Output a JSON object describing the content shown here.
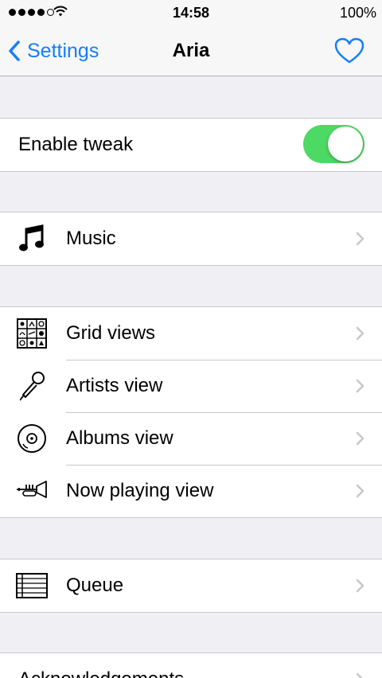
{
  "status_bar": {
    "time": "14:58",
    "battery": "100%",
    "signal_icon": "signal-dots-icon",
    "wifi_icon": "wifi-icon"
  },
  "nav": {
    "back_label": "Settings",
    "title": "Aria",
    "heart_icon": "heart-icon",
    "accent_color": "#157efb"
  },
  "toggle_row": {
    "label": "Enable tweak",
    "enabled": true,
    "on_color": "#4cd964"
  },
  "groups": [
    {
      "items": [
        {
          "label": "Music",
          "icon": "music-note-icon"
        }
      ]
    },
    {
      "items": [
        {
          "label": "Grid views",
          "icon": "grid-icon"
        },
        {
          "label": "Artists view",
          "icon": "microphone-icon"
        },
        {
          "label": "Albums view",
          "icon": "vinyl-disc-icon"
        },
        {
          "label": "Now playing view",
          "icon": "trumpet-icon"
        }
      ]
    },
    {
      "items": [
        {
          "label": "Queue",
          "icon": "queue-list-icon"
        }
      ]
    },
    {
      "items": [
        {
          "label": "Acknowledgements",
          "icon": ""
        }
      ]
    }
  ]
}
